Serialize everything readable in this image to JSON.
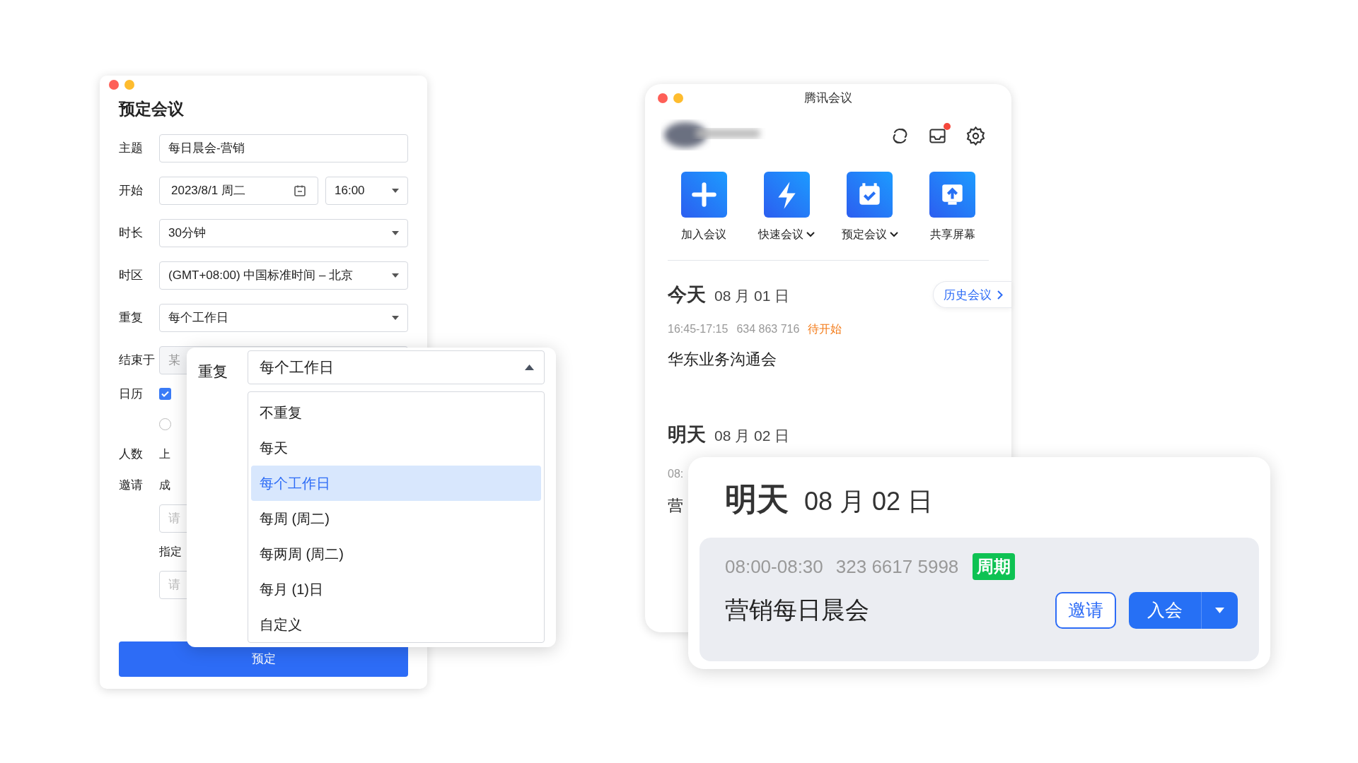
{
  "schedule_window": {
    "title": "预定会议",
    "fields": [
      {
        "kind": "text",
        "label": "主题",
        "value": "每日晨会-营销"
      },
      {
        "kind": "datetime",
        "label": "开始",
        "value": "2023/8/1 周二",
        "time": "16:00"
      },
      {
        "kind": "select",
        "label": "时长",
        "value": "30分钟"
      },
      {
        "kind": "select",
        "label": "时区",
        "value": "(GMT+08:00) 中国标准时间 – 北京"
      },
      {
        "kind": "select",
        "label": "重复",
        "value": "每个工作日"
      }
    ],
    "hidden_rows": [
      {
        "kind": "field",
        "label": "结束于",
        "value": "某"
      },
      {
        "kind": "checkbox",
        "label": "日历",
        "checked": true
      },
      {
        "kind": "radio",
        "selected": false
      },
      {
        "kind": "plain",
        "label": "人数",
        "value": "上"
      },
      {
        "kind": "plain",
        "label": "邀请",
        "value": "成"
      },
      {
        "kind": "placeholder",
        "placeholder": "请"
      },
      {
        "kind": "plain",
        "value": "指定"
      },
      {
        "kind": "placeholder",
        "placeholder": "请"
      }
    ],
    "submit_button": "预定"
  },
  "repeat_dropdown": {
    "label": "重复",
    "value": "每个工作日",
    "expanded": true,
    "options": [
      {
        "label": "不重复",
        "selected": false
      },
      {
        "label": "每天",
        "selected": false
      },
      {
        "label": "每个工作日",
        "selected": true
      },
      {
        "label": "每周 (周二)",
        "selected": false
      },
      {
        "label": "每两周 (周二)",
        "selected": false
      },
      {
        "label": "每月 (1)日",
        "selected": false
      },
      {
        "label": "自定义",
        "selected": false
      }
    ]
  },
  "main_window": {
    "title": "腾讯会议",
    "actions": [
      {
        "kind": "join",
        "label": "加入会议",
        "has_menu": false
      },
      {
        "kind": "quick",
        "label": "快速会议",
        "has_menu": true
      },
      {
        "kind": "schedule",
        "label": "预定会议",
        "has_menu": true
      },
      {
        "kind": "share",
        "label": "共享屏幕",
        "has_menu": false
      }
    ],
    "today": {
      "day": "今天",
      "date": "08 月 01 日",
      "history_button": "历史会议",
      "time": "16:45-17:15",
      "meeting_id": "634 863 716",
      "status": "待开始",
      "title": "华东业务沟通会"
    },
    "tomorrow": {
      "day": "明天",
      "date": "08 月 02 日",
      "time_partial": "08:",
      "title_partial": "营"
    }
  },
  "meeting_card": {
    "day": "明天",
    "date": "08 月 02 日",
    "time": "08:00-08:30",
    "meeting_id": "323 6617 5998",
    "tag": "周期",
    "title": "营销每日晨会",
    "invite_button": "邀请",
    "join_button": "入会"
  }
}
